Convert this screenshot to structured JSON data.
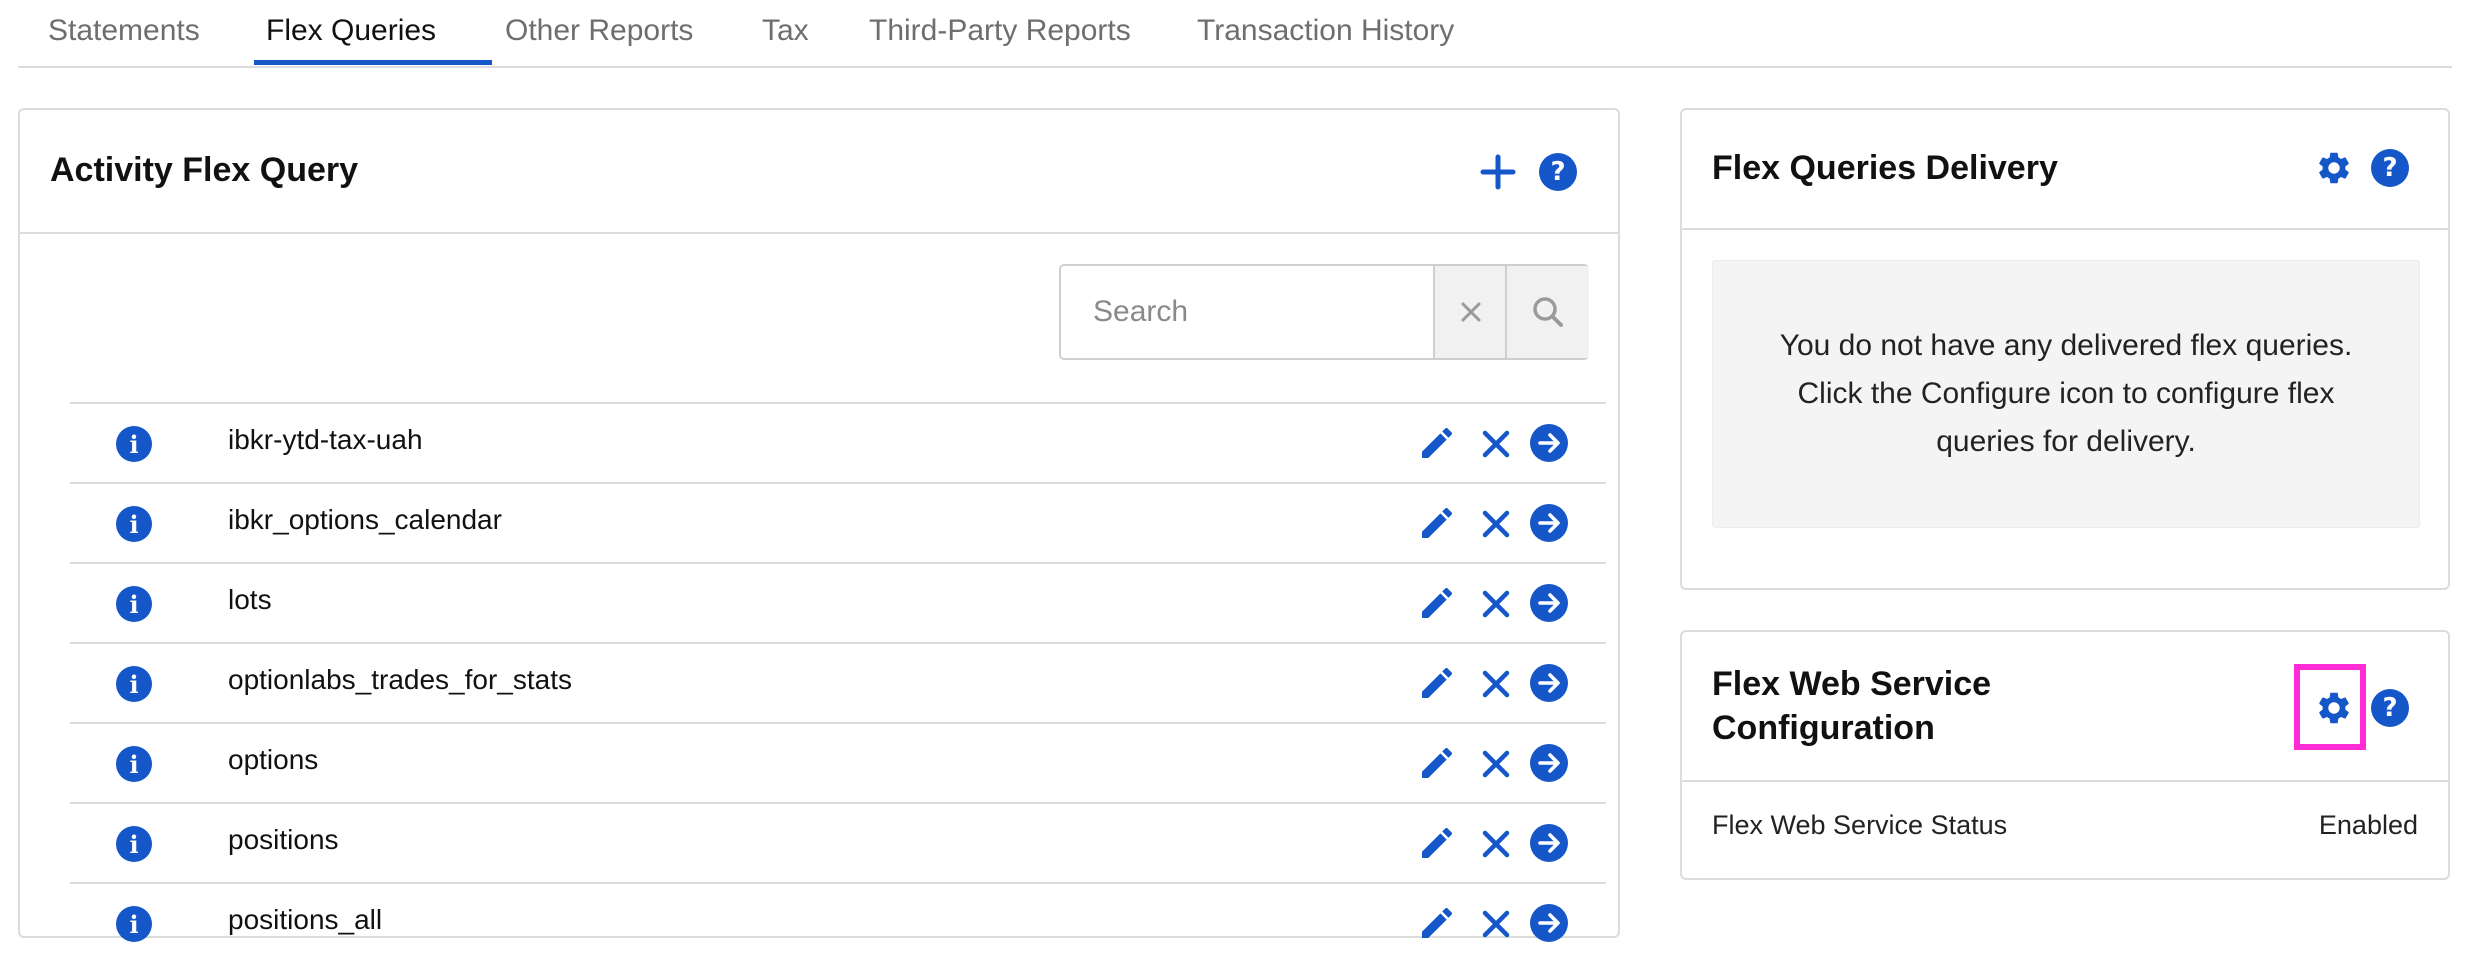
{
  "tabs": [
    {
      "label": "Statements",
      "active": false
    },
    {
      "label": "Flex Queries",
      "active": true
    },
    {
      "label": "Other Reports",
      "active": false
    },
    {
      "label": "Tax",
      "active": false
    },
    {
      "label": "Third-Party Reports",
      "active": false
    },
    {
      "label": "Transaction History",
      "active": false
    }
  ],
  "activity_panel": {
    "title": "Activity Flex Query",
    "add_icon": "plus-icon",
    "help_icon": "help-icon",
    "help_glyph": "?",
    "search": {
      "placeholder": "Search",
      "value": "",
      "clear_icon": "x-icon",
      "go_icon": "magnifier-icon"
    },
    "info_glyph": "i",
    "queries": [
      {
        "name": "ibkr-ytd-tax-uah"
      },
      {
        "name": "ibkr_options_calendar"
      },
      {
        "name": "lots"
      },
      {
        "name": "optionlabs_trades_for_stats"
      },
      {
        "name": "options"
      },
      {
        "name": "positions"
      },
      {
        "name": "positions_all"
      }
    ],
    "row_icons": [
      "info-icon",
      "pencil-icon",
      "x-icon",
      "arrow-right-circle-icon"
    ]
  },
  "delivery_panel": {
    "title": "Flex Queries Delivery",
    "message": "You do not have any delivered flex queries. Click the Configure icon to configure flex queries for delivery.",
    "configure_icon": "gear-icon",
    "help_icon": "help-icon",
    "help_glyph": "?"
  },
  "web_service_panel": {
    "title": "Flex Web Service Configuration",
    "status_label": "Flex Web Service Status",
    "status_value": "Enabled",
    "configure_icon": "gear-icon",
    "help_icon": "help-icon",
    "help_glyph": "?",
    "configure_highlighted": true
  },
  "colors": {
    "accent": "#1556c8",
    "highlight": "#ff2bd6",
    "border": "#dcdcdc",
    "muted_text": "#6e6e6e"
  }
}
